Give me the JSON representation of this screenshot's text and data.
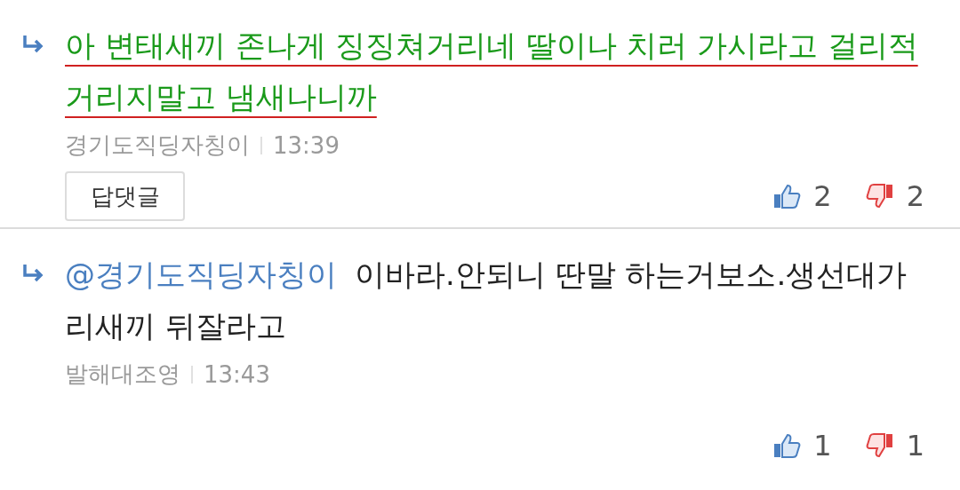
{
  "comments": [
    {
      "highlighted": true,
      "text": "아 변태새끼 존나게 징징쳐거리네 딸이나 치러 가시라고 걸리적 거리지말고 냄새나니까",
      "author": "경기도직딩자칭이",
      "time": "13:39",
      "reply_button": "답댓글",
      "likes": "2",
      "dislikes": "2"
    },
    {
      "highlighted": false,
      "mention": "@경기도직딩자칭이",
      "text": "이바라.안되니 딴말 하는거보소.생선대가리새끼 뒤잘라고",
      "author": "발해대조영",
      "time": "13:43",
      "likes": "1",
      "dislikes": "1"
    }
  ]
}
